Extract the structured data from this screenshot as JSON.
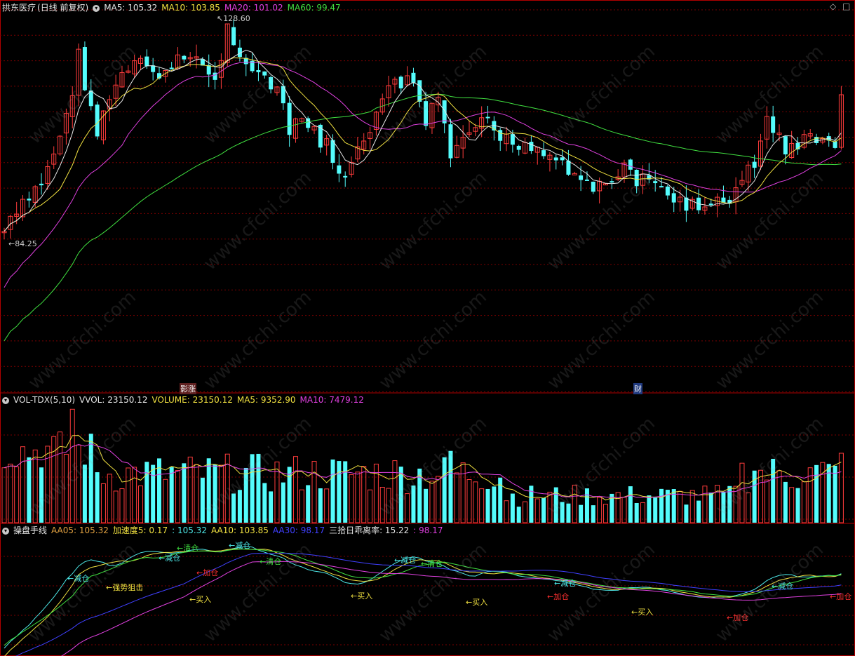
{
  "main_panel": {
    "stock_name": "拱东医疗",
    "period_label": "(日线 前复权)",
    "indicators": [
      {
        "label": "MA5:",
        "value": "105.32",
        "color": "#e6e6e6"
      },
      {
        "label": "MA10:",
        "value": "103.85",
        "color": "#f0e040"
      },
      {
        "label": "MA20:",
        "value": "101.02",
        "color": "#e040e0"
      },
      {
        "label": "MA60:",
        "value": "99.47",
        "color": "#40e040"
      }
    ],
    "high_marker": "128.60",
    "low_marker": "84.25",
    "event_left": "影涨",
    "event_right": "财"
  },
  "volume_panel": {
    "name": "VOL-TDX(5,10)",
    "items": [
      {
        "text": "VVOL: 23150.12",
        "color": "#e6e6e6"
      },
      {
        "text": "VOLUME: 23150.12",
        "color": "#f0e040"
      },
      {
        "text": "MA5: 9352.90",
        "color": "#f0e040"
      },
      {
        "text": "MA10: 7479.12",
        "color": "#e040e0"
      }
    ]
  },
  "signal_panel": {
    "name": "操盘手线",
    "items": [
      {
        "text": "AA05: 105.32",
        "color": "#e0a040"
      },
      {
        "text": "加速度5: 0.17",
        "color": "#f0e040"
      },
      {
        "text": ": 105.32",
        "color": "#4de8e8"
      },
      {
        "text": "AA10: 103.85",
        "color": "#f0e040"
      },
      {
        "text": "AA30: 98.17",
        "color": "#4040ff"
      },
      {
        "text": "三拾日乖离率: 15.22",
        "color": "#e6e6e6"
      },
      {
        "text": ": 98.17",
        "color": "#e040e0"
      }
    ],
    "signals": [
      {
        "text": "←减仓",
        "color": "#4de8e8"
      },
      {
        "text": "←强势狙击",
        "color": "#f0e040"
      },
      {
        "text": "←减仓",
        "color": "#4de8e8"
      },
      {
        "text": "←清仓",
        "color": "#40e040"
      },
      {
        "text": "←减仓",
        "color": "#4de8e8"
      },
      {
        "text": "←加仓",
        "color": "#ff3030"
      },
      {
        "text": "←清仓",
        "color": "#40e040"
      },
      {
        "text": "←买入",
        "color": "#f0e040"
      },
      {
        "text": "←减仓",
        "color": "#4de8e8"
      },
      {
        "text": "←清仓",
        "color": "#40e040"
      },
      {
        "text": "←买入",
        "color": "#f0e040"
      },
      {
        "text": "←买入",
        "color": "#f0e040"
      },
      {
        "text": "←减仓",
        "color": "#4de8e8"
      },
      {
        "text": "←加仓",
        "color": "#ff3030"
      },
      {
        "text": "←买入",
        "color": "#f0e040"
      },
      {
        "text": "←加仓",
        "color": "#ff3030"
      },
      {
        "text": "←减仓",
        "color": "#4de8e8"
      },
      {
        "text": "←加仓",
        "color": "#ff3030"
      }
    ]
  },
  "watermark": "www.cfchi.com",
  "colors": {
    "up": "#ff3c3c",
    "down": "#54fcfc",
    "grid": "#7a0000",
    "border": "#b00000"
  }
}
